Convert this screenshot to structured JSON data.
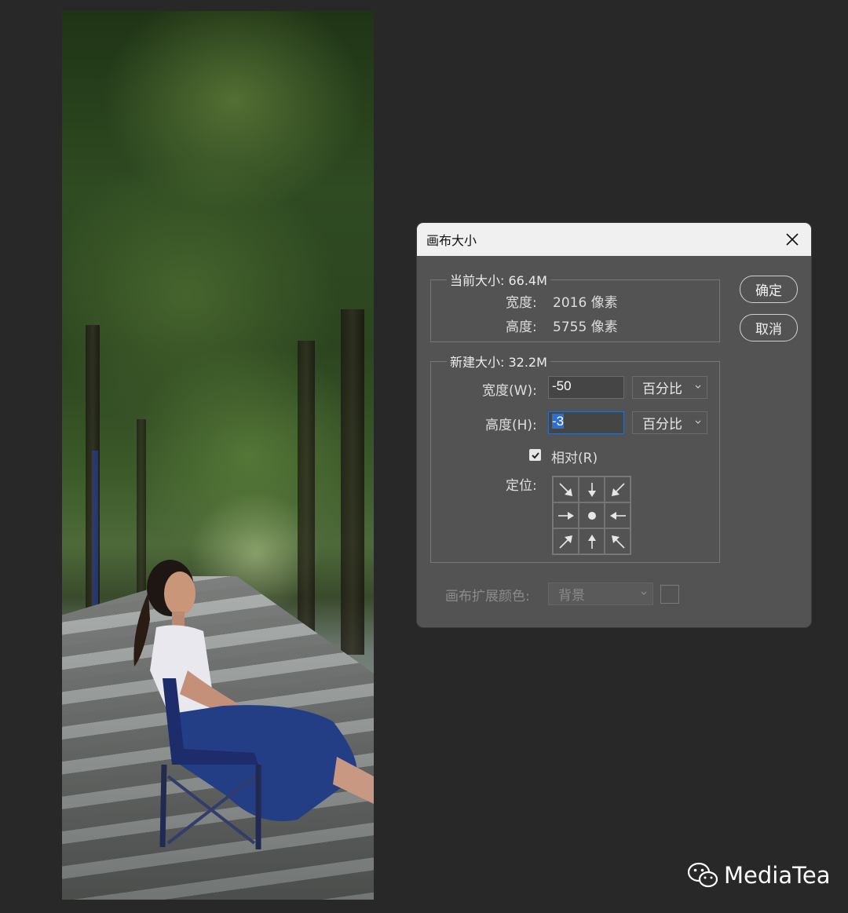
{
  "dialog": {
    "title": "画布大小",
    "current": {
      "legend": "当前大小: 66.4M",
      "width_label": "宽度:",
      "width_value": "2016 像素",
      "height_label": "高度:",
      "height_value": "5755 像素"
    },
    "new": {
      "legend": "新建大小: 32.2M",
      "width_label": "宽度(W):",
      "width_value": "-50",
      "width_unit": "百分比",
      "height_label": "高度(H):",
      "height_value": "-3",
      "height_unit": "百分比",
      "relative_label": "相对(R)",
      "relative_checked": true,
      "anchor_label": "定位:"
    },
    "extension_color_label": "画布扩展颜色:",
    "extension_color_value": "背景",
    "ok_label": "确定",
    "cancel_label": "取消"
  },
  "watermark": {
    "text": "MediaTea"
  },
  "colors": {
    "dialog_bg": "#535353",
    "titlebar_bg": "#f0f0f0",
    "selection": "#2e6fcf",
    "app_bg": "#282828"
  }
}
